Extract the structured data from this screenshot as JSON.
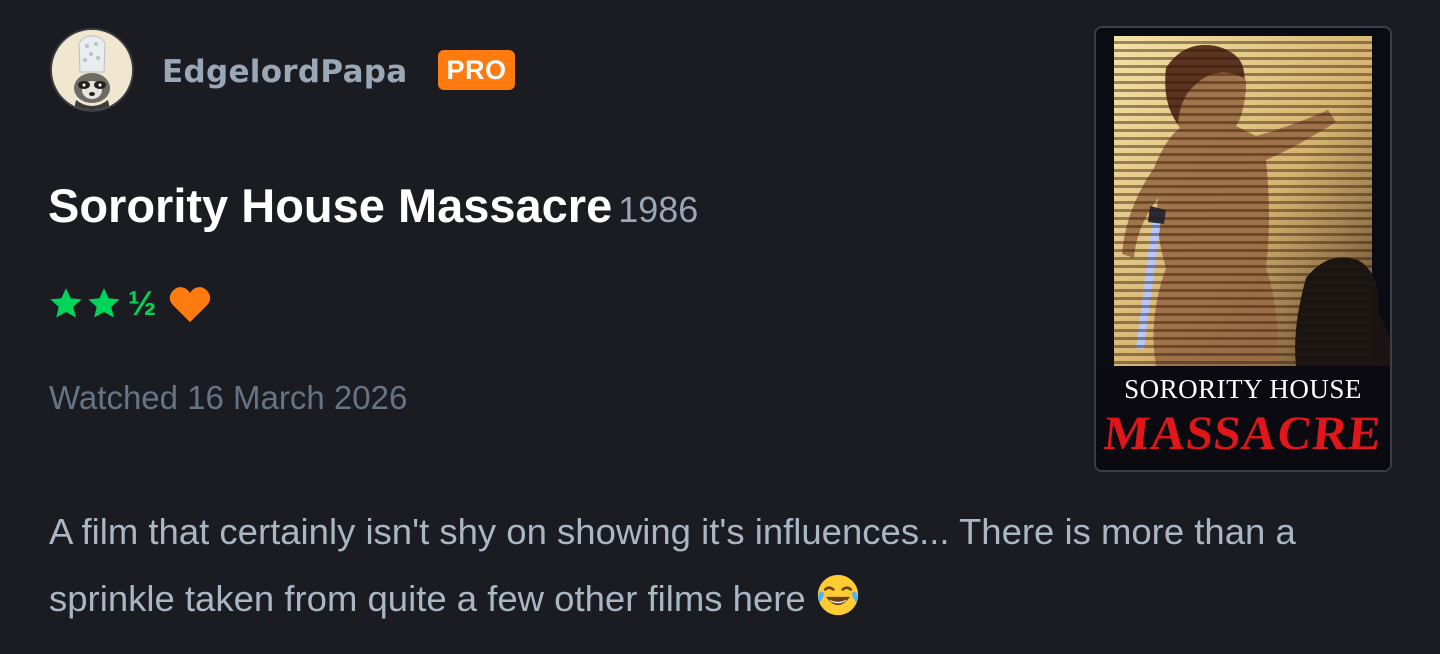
{
  "reviewer": {
    "username": "EdgelordPapa",
    "badge": "PRO",
    "avatar_icon": "raccoon-chef-avatar"
  },
  "film": {
    "title": "Sorority House Massacre",
    "year": "1986"
  },
  "rating": {
    "stars": 2.5,
    "half_symbol": "½",
    "liked": true,
    "star_color": "#00d45b",
    "heart_color": "#ff7a0f"
  },
  "watched": "Watched 16 March 2026",
  "poster": {
    "line1": "SORORITY HOUSE",
    "line2": "MASSACRE"
  },
  "review": {
    "text": "A film that certainly isn't shy on showing it's influences... There is more than a sprinkle taken from quite a few other films here",
    "emoji": "face-with-tears-of-joy-icon"
  },
  "colors": {
    "background": "#1a1c21",
    "pro_badge": "#ff7a0f",
    "muted_text": "#9aa7b6"
  }
}
